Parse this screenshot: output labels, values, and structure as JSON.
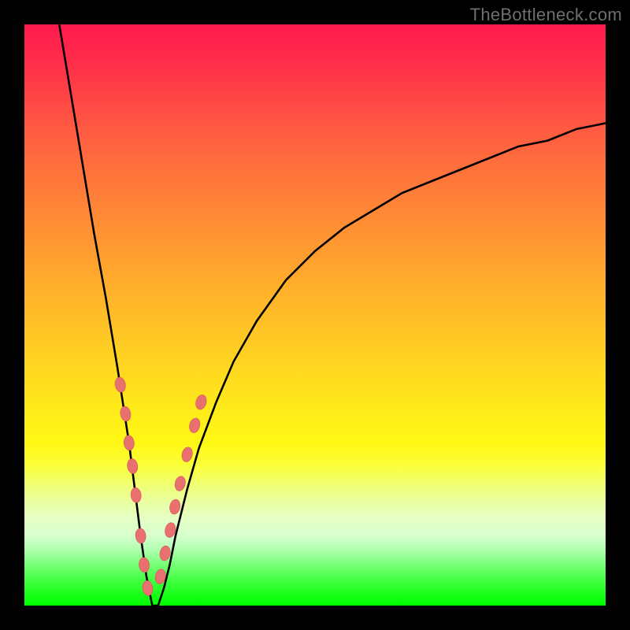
{
  "watermark": "TheBottleneck.com",
  "colors": {
    "frame": "#000000",
    "curve_stroke": "#000000",
    "marker_fill": "#e8706f",
    "marker_stroke": "#d45a59"
  },
  "chart_data": {
    "type": "line",
    "title": "",
    "xlabel": "",
    "ylabel": "",
    "xlim": [
      0,
      100
    ],
    "ylim": [
      0,
      100
    ],
    "description": "Bottleneck curve: sharp V-shaped minimum near x≈22 (y≈0), rising steeply to y≈100 at x≈6 on the left and gradually to y≈83 at x=100 on the right. Background gradient encodes y-value (red=high bottleneck, green=optimal).",
    "series": [
      {
        "name": "bottleneck_curve",
        "x": [
          6,
          8,
          10,
          12,
          14,
          16,
          18,
          19,
          20,
          21,
          22,
          23,
          24,
          25,
          26,
          28,
          30,
          33,
          36,
          40,
          45,
          50,
          55,
          60,
          65,
          70,
          75,
          80,
          85,
          90,
          95,
          100
        ],
        "y": [
          100,
          88,
          76,
          64,
          53,
          41,
          28,
          20,
          12,
          5,
          0,
          0,
          3,
          7,
          12,
          20,
          27,
          35,
          42,
          49,
          56,
          61,
          65,
          68,
          71,
          73,
          75,
          77,
          79,
          80,
          82,
          83
        ]
      },
      {
        "name": "markers_left_branch",
        "x": [
          16.5,
          17.4,
          18.0,
          18.6,
          19.2,
          20.0,
          20.6,
          21.2
        ],
        "y": [
          38,
          33,
          28,
          24,
          19,
          12,
          7,
          3
        ]
      },
      {
        "name": "markers_right_branch",
        "x": [
          23.4,
          24.2,
          25.1,
          25.9,
          26.8,
          28.0,
          29.3,
          30.4
        ],
        "y": [
          5,
          9,
          13,
          17,
          21,
          26,
          31,
          35
        ]
      }
    ]
  }
}
